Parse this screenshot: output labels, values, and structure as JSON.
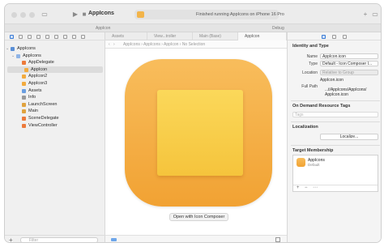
{
  "window": {
    "scheme_name": "AppIcons",
    "status": "Finished running AppIcons on iPhone 16 Pro",
    "tabstrip": {
      "left": "AppIcon",
      "right": "Debug"
    }
  },
  "navigator": {
    "filter_placeholder": "Filter",
    "items": [
      {
        "label": "AppIcons",
        "level": 0,
        "kind": "project"
      },
      {
        "label": "AppIcons",
        "level": 1,
        "kind": "folder"
      },
      {
        "label": "AppDelegate",
        "level": 2,
        "kind": "swift"
      },
      {
        "label": "AppIcon",
        "level": 2,
        "kind": "icon"
      },
      {
        "label": "AppIcon2",
        "level": 2,
        "kind": "icon"
      },
      {
        "label": "AppIcon3",
        "level": 2,
        "kind": "icon"
      },
      {
        "label": "Assets",
        "level": 2,
        "kind": "assets"
      },
      {
        "label": "Info",
        "level": 2,
        "kind": "plist"
      },
      {
        "label": "LaunchScreen",
        "level": 2,
        "kind": "storyboard"
      },
      {
        "label": "Main",
        "level": 2,
        "kind": "storyboard"
      },
      {
        "label": "SceneDelegate",
        "level": 2,
        "kind": "swift"
      },
      {
        "label": "ViewController",
        "level": 2,
        "kind": "swift"
      }
    ],
    "selected_index": 3
  },
  "editor": {
    "tabs": [
      {
        "label": "Assets",
        "active": false
      },
      {
        "label": "View...troller",
        "active": false
      },
      {
        "label": "Main (Base)",
        "active": false
      },
      {
        "label": "AppIcon",
        "active": true
      }
    ],
    "jumpbar": "AppIcons  ›  AppIcons  ›  AppIcon  ›  No Selection",
    "open_button": "Open with Icon Composer"
  },
  "inspector": {
    "identity_title": "Identity and Type",
    "name_label": "Name",
    "name_value": "AppIcon.icon",
    "type_label": "Type",
    "type_value": "Default - Icon Composer I...",
    "location_label": "Location",
    "location_value": "Relative to Group",
    "location_file": "AppIcon.icon",
    "fullpath_label": "Full Path",
    "fullpath_value": "...t/AppIcons/AppIcons/ AppIcon.icon",
    "odr_title": "On Demand Resource Tags",
    "tags_placeholder": "Tags",
    "localization_title": "Localization",
    "localize_button": "Localize...",
    "target_title": "Target Membership",
    "target_name": "AppIcons",
    "target_sub": "Default",
    "add_symbol": "+",
    "remove_symbol": "−",
    "more_symbol": "⋯"
  },
  "colors": {
    "icon_outer": "#f1a233",
    "icon_inner": "#f5c43c",
    "accent": "#3a7bd5"
  }
}
